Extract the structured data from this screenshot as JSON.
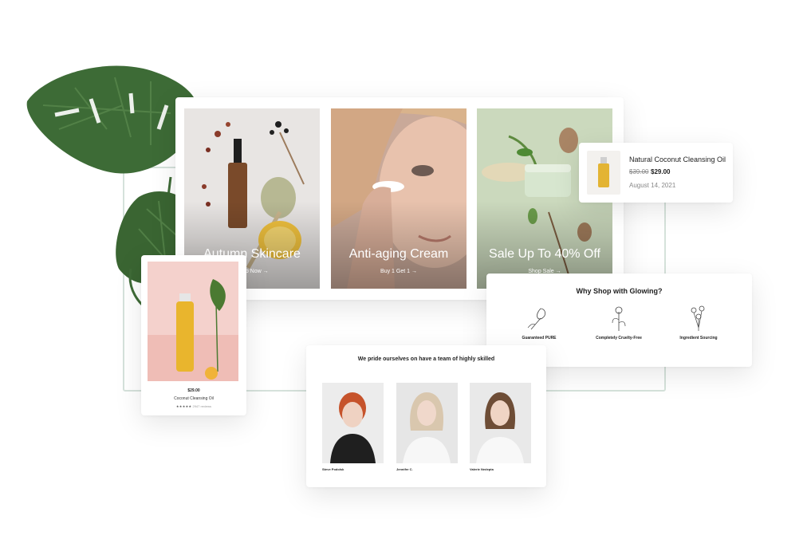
{
  "banners": [
    {
      "title": "Autumn Skincare",
      "link": "Shop Now →"
    },
    {
      "title": "Anti-aging Cream",
      "link": "Buy 1 Get 1 →"
    },
    {
      "title": "Sale Up To 40% Off",
      "link": "Shop Sale →"
    }
  ],
  "product_notification": {
    "name": "Natural Coconut Cleansing Oil",
    "old_price": "$39.00",
    "price": "$29.00",
    "date": "August 14, 2021"
  },
  "why_shop": {
    "title": "Why Shop with Glowing?",
    "features": [
      {
        "title": "Guaranteed PURE",
        "icon": "flower-icon"
      },
      {
        "title": "Completely Cruelty-Free",
        "icon": "floral-sprig-icon"
      },
      {
        "title": "Ingredient Sourcing",
        "icon": "herb-icon"
      }
    ]
  },
  "product": {
    "price": "$29.00",
    "name": "Coconut Cleansing Oil",
    "stars": "★★★★★",
    "reviews": "2947 reviews"
  },
  "team": {
    "title": "We pride ourselves on have a team of highly skilled",
    "members": [
      {
        "name": "Steve Podolsk"
      },
      {
        "name": "Jennifer C."
      },
      {
        "name": "Valerie Nedepta"
      }
    ]
  },
  "colors": {
    "frame_outline": "#d5e2db",
    "leaf_green": "#3d6b36",
    "sage_banner": "#cbd9bd",
    "pink_backdrop": "#f4d1cc"
  }
}
